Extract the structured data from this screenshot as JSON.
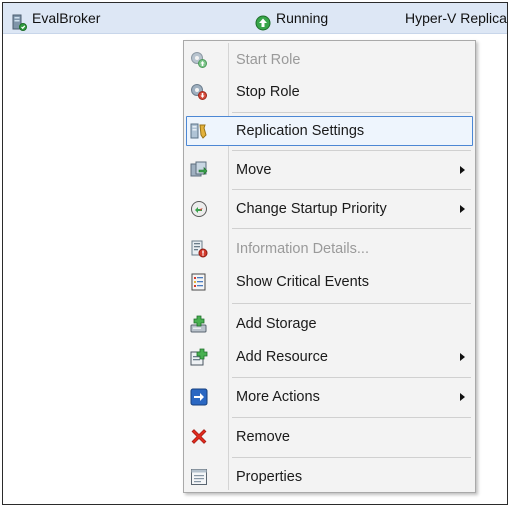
{
  "row": {
    "name": "EvalBroker",
    "status": "Running",
    "type": "Hyper-V Replica"
  },
  "menu": {
    "items": [
      {
        "label": "Start Role",
        "icon": "start-role-icon",
        "disabled": true
      },
      {
        "label": "Stop Role",
        "icon": "stop-role-icon"
      },
      {
        "label": "Replication Settings",
        "icon": "replication-settings-icon",
        "selected": true
      },
      {
        "label": "Move",
        "icon": "move-icon",
        "submenu": true
      },
      {
        "label": "Change Startup Priority",
        "icon": "startup-priority-icon",
        "submenu": true
      },
      {
        "label": "Information Details...",
        "icon": "information-details-icon",
        "disabled": true
      },
      {
        "label": "Show Critical Events",
        "icon": "critical-events-icon"
      },
      {
        "label": "Add Storage",
        "icon": "add-storage-icon"
      },
      {
        "label": "Add Resource",
        "icon": "add-resource-icon",
        "submenu": true
      },
      {
        "label": "More Actions",
        "icon": "more-actions-icon",
        "submenu": true
      },
      {
        "label": "Remove",
        "icon": "remove-icon"
      },
      {
        "label": "Properties",
        "icon": "properties-icon"
      }
    ]
  },
  "colors": {
    "selection_border": "#4c87d4",
    "row_background": "#dde7f5",
    "disabled_text": "#9a9a9a"
  }
}
